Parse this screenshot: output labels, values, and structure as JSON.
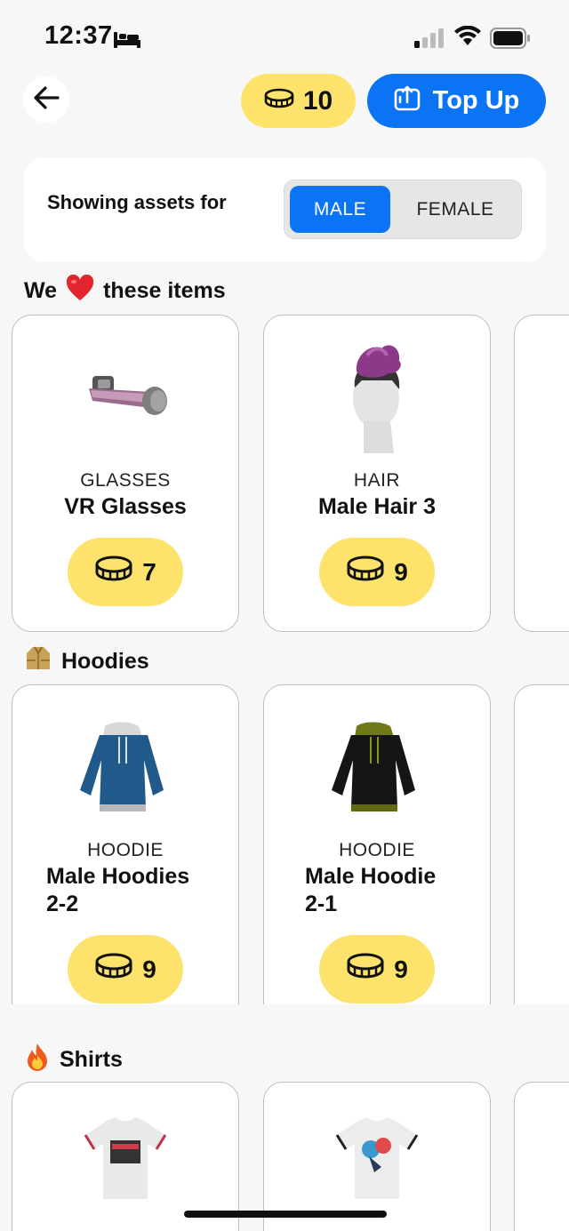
{
  "status_bar": {
    "time": "12:37"
  },
  "header": {
    "coin_balance": "10",
    "topup_label": "Top Up"
  },
  "gender": {
    "label": "Showing assets for",
    "options": [
      "MALE",
      "FEMALE"
    ],
    "selected": "MALE"
  },
  "sections": [
    {
      "title_prefix": "We",
      "title_suffix": "these items",
      "icon": "heart-emoji",
      "items": [
        {
          "category": "GLASSES",
          "name": "VR Glasses",
          "price": "7"
        },
        {
          "category": "HAIR",
          "name": "Male Hair 3",
          "price": "9"
        }
      ]
    },
    {
      "title": "Hoodies",
      "icon": "coat-emoji",
      "items": [
        {
          "category": "HOODIE",
          "name_line1": "Male Hoodies",
          "name_line2": "2-2",
          "price": "9"
        },
        {
          "category": "HOODIE",
          "name_line1": "Male Hoodie",
          "name_line2": "2-1",
          "price": "9"
        }
      ]
    },
    {
      "title": "Shirts",
      "icon": "fire-emoji",
      "items": []
    }
  ],
  "colors": {
    "accent": "#0a74f5",
    "coin": "#fde36c",
    "background": "#f7f7f7"
  }
}
